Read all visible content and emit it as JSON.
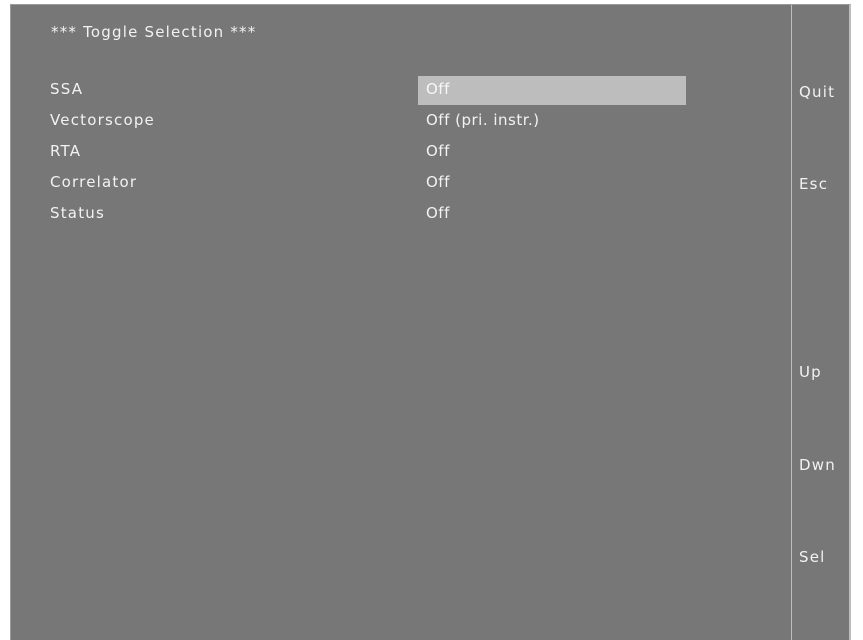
{
  "title": "*** Toggle Selection ***",
  "menu": {
    "items": [
      {
        "label": "SSA",
        "value": "Off",
        "selected": true
      },
      {
        "label": "Vectorscope",
        "value": "Off (pri. instr.)",
        "selected": false
      },
      {
        "label": "RTA",
        "value": "Off",
        "selected": false
      },
      {
        "label": "Correlator",
        "value": "Off",
        "selected": false
      },
      {
        "label": "Status",
        "value": "Off",
        "selected": false
      }
    ]
  },
  "softkeys": {
    "quit": "Quit",
    "esc": "Esc",
    "up": "Up",
    "dwn": "Dwn",
    "sel": "Sel"
  },
  "colors": {
    "screen_background": "#777777",
    "highlight": "#bdbdbd",
    "text": "#f2f2f2"
  }
}
